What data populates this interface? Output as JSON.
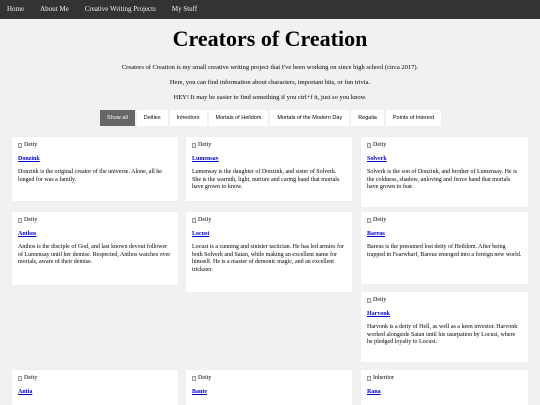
{
  "nav": {
    "items": [
      "Home",
      "About Me",
      "Creative Writing Projects",
      "My Stuff"
    ]
  },
  "page": {
    "title": "Creators of Creation",
    "intro": [
      "Creators of Creation is my small creative writing project that I've been working on since high school (circa 2017).",
      "Here, you can find information about characters, important bits, or fun trivia.",
      "HEY! It may be easier to find something if you ctrl+f it, just so you know."
    ]
  },
  "filters": {
    "items": [
      "Show all",
      "Deities",
      "Inheritors",
      "Mortals of Heildom",
      "Mortals of the Modern Day",
      "Regalia",
      "Points of Interest"
    ],
    "active": "Show all"
  },
  "cards": [
    {
      "img_alt": "Deity",
      "name": "Donzink",
      "desc": "Donzink is the original creator of the universe. Alone, all he longed for was a family."
    },
    {
      "img_alt": "Deity",
      "name": "Lumensay",
      "desc": "Lumensay is the daughter of Donzink, and sister of Solverk. She is the warmth, light, nurture and caring hand that mortals have grown to know."
    },
    {
      "img_alt": "Deity",
      "name": "Solverk",
      "desc": "Solverk is the son of Donzink, and brother of Lumensay. He is the coldness, shadow, unloving and fierce hand that mortals have grown to fear."
    },
    {
      "img_alt": "Deity",
      "name": "Anthos",
      "desc": "Anthos is the disciple of God, and last known devout follower of Lumensay until her demise. Respected, Anthos watches over mortals, aware of their demise."
    },
    {
      "img_alt": "Deity",
      "name": "Locust",
      "desc": "Locust is a cunning and sinister tactician. He has led armies for both Solverk and Satan, while making an excellent name for himself. He is a master of demonic magic, and an excellent trickster."
    },
    {
      "img_alt": "Deity",
      "name": "Bareus",
      "desc": "Bareus is the presumed lost deity of Heildom. After being trapped in Fearwharf, Bareus emerged into a foreign new world."
    },
    {
      "img_alt": "Deity",
      "name": "Harvonk",
      "desc": "Harvonk is a deity of Hell, as well as a keen investor. Harvonk worked alongside Satan until his usurpation by Locust, where he pledged loyalty to Locust."
    },
    {
      "img_alt": "Deity",
      "name": "Antia",
      "desc": ""
    },
    {
      "img_alt": "Deity",
      "name": "Bante",
      "desc": ""
    },
    {
      "img_alt": "Inheritor",
      "name": "Rana",
      "desc": ""
    }
  ]
}
